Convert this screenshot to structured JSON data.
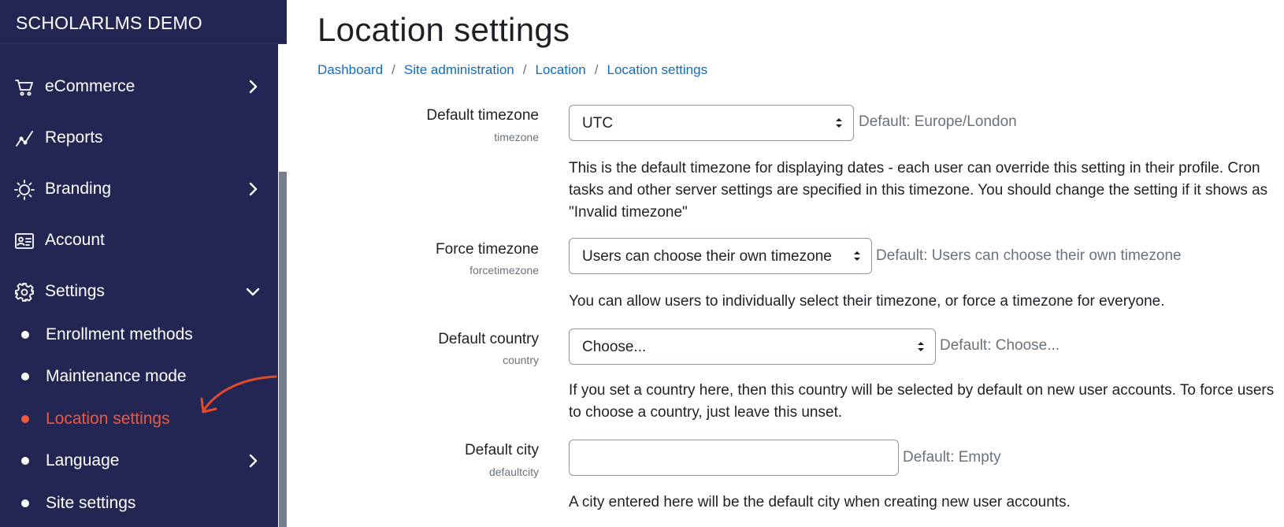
{
  "brand": "SCHOLARLMS DEMO",
  "sidebar": {
    "items": [
      {
        "label": "eCommerce",
        "icon": "cart-icon",
        "has_chevron": true
      },
      {
        "label": "Reports",
        "icon": "chart-line-icon"
      },
      {
        "label": "Branding",
        "icon": "sun-icon",
        "has_chevron": true
      },
      {
        "label": "Account",
        "icon": "id-card-icon"
      },
      {
        "label": "Settings",
        "icon": "gear-icon",
        "expanded": true
      }
    ],
    "subitems": [
      {
        "label": "Enrollment methods"
      },
      {
        "label": "Maintenance mode"
      },
      {
        "label": "Location settings",
        "active": true
      },
      {
        "label": "Language",
        "has_chevron": true
      },
      {
        "label": "Site settings"
      }
    ],
    "active_color": "#f0573b"
  },
  "page": {
    "title": "Location settings",
    "breadcrumb": [
      "Dashboard",
      "Site administration",
      "Location",
      "Location settings"
    ]
  },
  "fields": {
    "timezone": {
      "label": "Default timezone",
      "name": "timezone",
      "value": "UTC",
      "default": "Default: Europe/London",
      "description": "This is the default timezone for displaying dates - each user can override this setting in their profile. Cron tasks and other server settings are specified in this timezone. You should change the setting if it shows as \"Invalid timezone\""
    },
    "forcetimezone": {
      "label": "Force timezone",
      "name": "forcetimezone",
      "value": "Users can choose their own timezone",
      "default": "Default: Users can choose their own timezone",
      "description": "You can allow users to individually select their timezone, or force a timezone for everyone."
    },
    "country": {
      "label": "Default country",
      "name": "country",
      "value": "Choose...",
      "default": "Default: Choose...",
      "description": "If you set a country here, then this country will be selected by default on new user accounts. To force users to choose a country, just leave this unset."
    },
    "defaultcity": {
      "label": "Default city",
      "name": "defaultcity",
      "value": "",
      "default": "Default: Empty",
      "description": "A city entered here will be the default city when creating new user accounts."
    }
  }
}
